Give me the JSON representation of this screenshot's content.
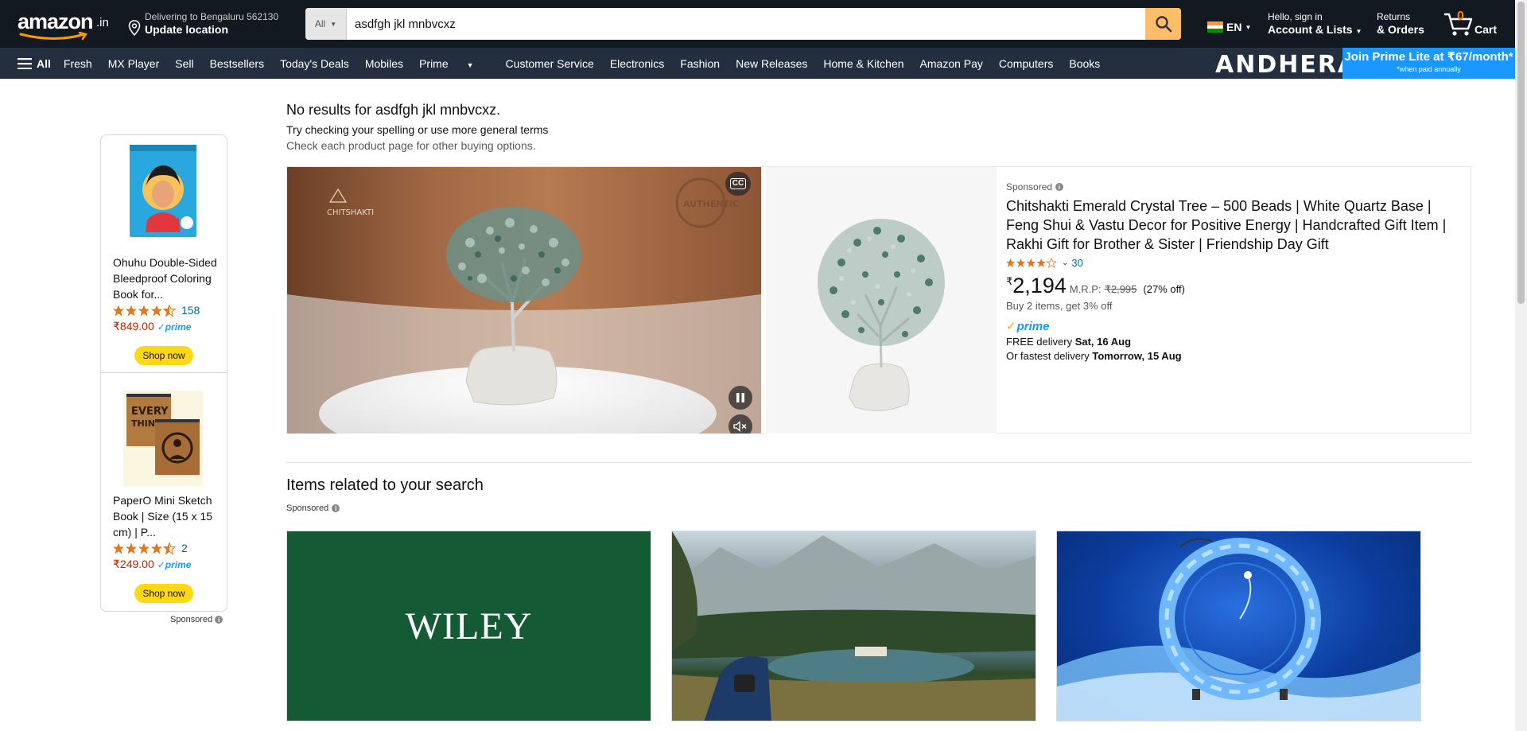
{
  "header": {
    "logo_suffix": ".in",
    "location_line1": "Delivering to Bengaluru 562130",
    "location_line2": "Update location",
    "search_dept": "All",
    "search_value": "asdfgh jkl mnbvcxz",
    "lang": "EN",
    "account_line1": "Hello, sign in",
    "account_line2": "Account & Lists",
    "orders_line1": "Returns",
    "orders_line2": "& Orders",
    "cart_count": "0",
    "cart_label": "Cart"
  },
  "nav": {
    "all_label": "All",
    "links": [
      "Fresh",
      "MX Player",
      "Sell",
      "Bestsellers",
      "Today's Deals",
      "Mobiles",
      "Prime",
      "Customer Service",
      "Electronics",
      "Fashion",
      "New Releases",
      "Home & Kitchen",
      "Amazon Pay",
      "Computers",
      "Books"
    ],
    "promo_brand": "ANDHERA",
    "prime_lite_line1": "Join Prime Lite at ₹67/month*",
    "prime_lite_line2": "*when paid annually"
  },
  "left_ads": [
    {
      "title": "Ohuhu Double-Sided Bleedproof Coloring Book for...",
      "rating": 4.5,
      "count": "158",
      "price": "₹849.00",
      "prime": "prime",
      "cta": "Shop now"
    },
    {
      "title": "PaperO Mini Sketch Book | Size (15 x 15 cm) | P...",
      "rating": 4.5,
      "count": "2",
      "price": "₹249.00",
      "prime": "prime",
      "cta": "Shop now"
    }
  ],
  "left_sponsored": "Sponsored",
  "results": {
    "no_results": "No results for asdfgh jkl mnbvcxz.",
    "try_checking": "Try checking your spelling or use more general terms",
    "check_each": "Check each product page for other buying options."
  },
  "sponsored_product": {
    "label": "Sponsored",
    "title": "Chitshakti Emerald Crystal Tree – 500 Beads | White Quartz Base | Feng Shui & Vastu Decor for Positive Energy | Handcrafted Gift Item | Rakhi Gift for Brother & Sister | Friendship Day Gift",
    "rating": 4.0,
    "rating_count": "30",
    "price_symbol": "₹",
    "price": "2,194",
    "mrp_label": "M.R.P:",
    "mrp_value": "₹2,995",
    "discount": "(27% off)",
    "offer": "Buy 2 items, get 3% off",
    "prime": "prime",
    "free_delivery_prefix": "FREE delivery",
    "free_delivery_date": "Sat, 16 Aug",
    "fastest_prefix": "Or fastest delivery",
    "fastest_date": "Tomorrow, 15 Aug",
    "video_watermark": "CHITSHAKTI"
  },
  "related": {
    "title": "Items related to your search",
    "sponsored": "Sponsored",
    "tiles": [
      {
        "brand_text": "WILEY"
      },
      {
        "brand_text": ""
      },
      {
        "brand_text": ""
      }
    ]
  },
  "colors": {
    "nav_top": "#131921",
    "nav_main": "#232f3e",
    "search_button": "#febd69",
    "shop_button": "#ffd814",
    "price_red": "#b12704",
    "link_teal": "#007185",
    "star": "#de7921",
    "prime_blue": "#1a98ff"
  }
}
